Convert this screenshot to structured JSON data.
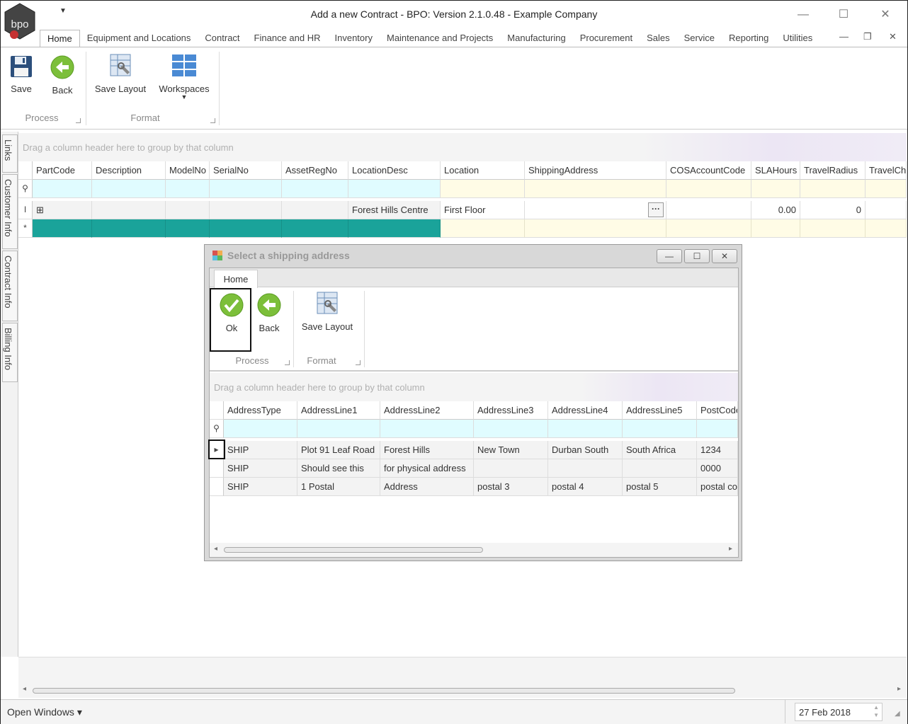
{
  "window": {
    "title": "Add a new Contract - BPO: Version 2.1.0.48 - Example Company",
    "logo_text": "bpo",
    "controls": {
      "minimize": "—",
      "maximize": "☐",
      "close": "✕"
    }
  },
  "menu_tabs": [
    "Home",
    "Equipment and Locations",
    "Contract",
    "Finance and HR",
    "Inventory",
    "Maintenance and Projects",
    "Manufacturing",
    "Procurement",
    "Sales",
    "Service",
    "Reporting",
    "Utilities"
  ],
  "mdi_controls": {
    "minimize": "—",
    "restore": "❐",
    "close": "✕"
  },
  "ribbon": {
    "save": "Save",
    "back": "Back",
    "save_layout": "Save Layout",
    "workspaces": "Workspaces",
    "group_process": "Process",
    "group_format": "Format"
  },
  "side_tabs": [
    "Links",
    "Customer Info",
    "Contract Info",
    "Billing Info"
  ],
  "main_grid": {
    "group_hint": "Drag a column header here to group by that column",
    "columns": [
      "PartCode",
      "Description",
      "ModelNo",
      "SerialNo",
      "AssetRegNo",
      "LocationDesc",
      "Location",
      "ShippingAddress",
      "COSAccountCode",
      "SLAHours",
      "TravelRadius",
      "TravelCh"
    ],
    "row": {
      "indicator": "I",
      "expand": "⊞",
      "LocationDesc": "Forest Hills Centre",
      "Location": "First Floor",
      "ellipsis": "···",
      "SLAHours": "0.00",
      "TravelRadius": "0"
    },
    "new_row_indicator": "*",
    "filter_indicator": "⚲"
  },
  "statusbar": {
    "open_windows": "Open Windows ▾",
    "date": "27 Feb 2018"
  },
  "dialog": {
    "title": "Select a shipping address",
    "tab": "Home",
    "ok": "Ok",
    "back": "Back",
    "save_layout": "Save Layout",
    "group_process": "Process",
    "group_format": "Format",
    "group_hint": "Drag a column header here to group by that column",
    "columns": [
      "AddressType",
      "AddressLine1",
      "AddressLine2",
      "AddressLine3",
      "AddressLine4",
      "AddressLine5",
      "PostCode"
    ],
    "rows": [
      [
        "SHIP",
        "Plot 91 Leaf Road",
        "Forest Hills",
        "New Town",
        "Durban South",
        "South Africa",
        "1234"
      ],
      [
        "SHIP",
        "Should see this",
        "for physical address",
        "",
        "",
        "",
        "0000"
      ],
      [
        "SHIP",
        "1 Postal",
        "Address",
        "postal 3",
        "postal 4",
        "postal 5",
        "postal co"
      ]
    ]
  }
}
